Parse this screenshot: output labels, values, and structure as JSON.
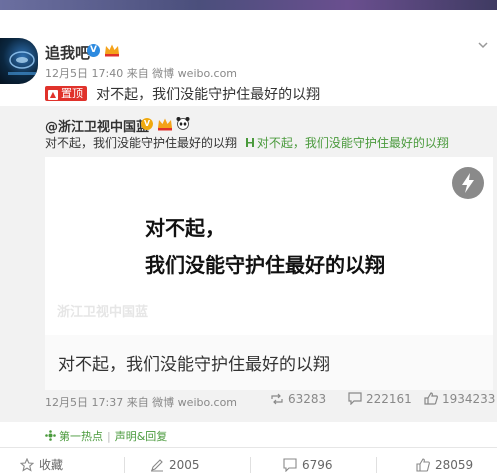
{
  "post": {
    "author": "追我吧",
    "meta": "12月5日 17:40 来自 微博 weibo.com",
    "pinned_label": "置顶",
    "text": "对不起，我们没能守护住最好的以翔"
  },
  "repost": {
    "author": "@浙江卫视中国蓝",
    "text": "对不起，我们没能守护住最好的以翔",
    "link_text": "对不起，我们没能守护住最好的以翔",
    "media_line1": "对不起，",
    "media_line2": "我们没能守护住最好的以翔",
    "watermark": "浙江卫视中国蓝",
    "caption": "对不起，我们没能守护住最好的以翔",
    "meta": "12月5日 17:37 来自 微博 weibo.com",
    "reposts": "63283",
    "comments": "222161",
    "likes": "1934233"
  },
  "topic": {
    "hot": "第一热点",
    "statement": "声明&回复"
  },
  "actions": {
    "favorite": "收藏",
    "repost": "2005",
    "comment": "6796",
    "like": "28059"
  },
  "colors": {
    "accent_green": "#4a9a3c",
    "pin_red": "#e0322b",
    "verified_blue": "#2c8ae0",
    "verified_gold": "#f0a90e"
  }
}
